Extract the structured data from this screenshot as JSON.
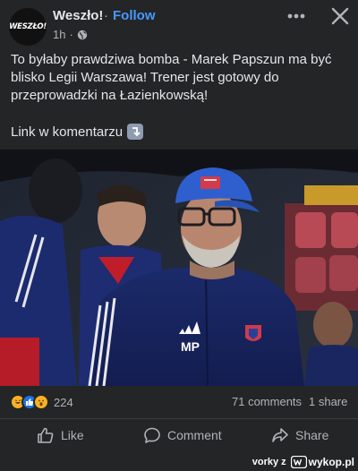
{
  "header": {
    "avatar_text": "WESZŁO!",
    "page_name": "Weszło!",
    "separator": "·",
    "follow_label": "Follow",
    "time": "1h",
    "privacy_icon": "globe-icon",
    "more_icon": "more-horizontal-icon",
    "close_icon": "close-icon"
  },
  "post": {
    "text_lines": [
      "To byłaby prawdziwa bomba - Marek Papszun ma być",
      "blisko Legii Warszawa! Trener jest gotowy do",
      "przeprowadzki na Łazienkowską!"
    ],
    "link_text": "Link w komentarzu",
    "link_emoji": "arrow-down-emoji"
  },
  "photo": {
    "cap_badge": "RAKÓW",
    "jacket_initials": "MP"
  },
  "stats": {
    "reaction_icons": [
      "haha-reaction-icon",
      "like-reaction-icon",
      "wow-reaction-icon"
    ],
    "reaction_count": "224",
    "comments": "71 comments",
    "shares": "1 share"
  },
  "actions": {
    "like_label": "Like",
    "comment_label": "Comment",
    "share_label": "Share"
  },
  "footer": {
    "user": "vorky z",
    "site": "wykop.pl"
  },
  "colors": {
    "background": "#242526",
    "accent": "#4599ff",
    "text": "#e4e6eb",
    "muted": "#b0b3b8"
  }
}
